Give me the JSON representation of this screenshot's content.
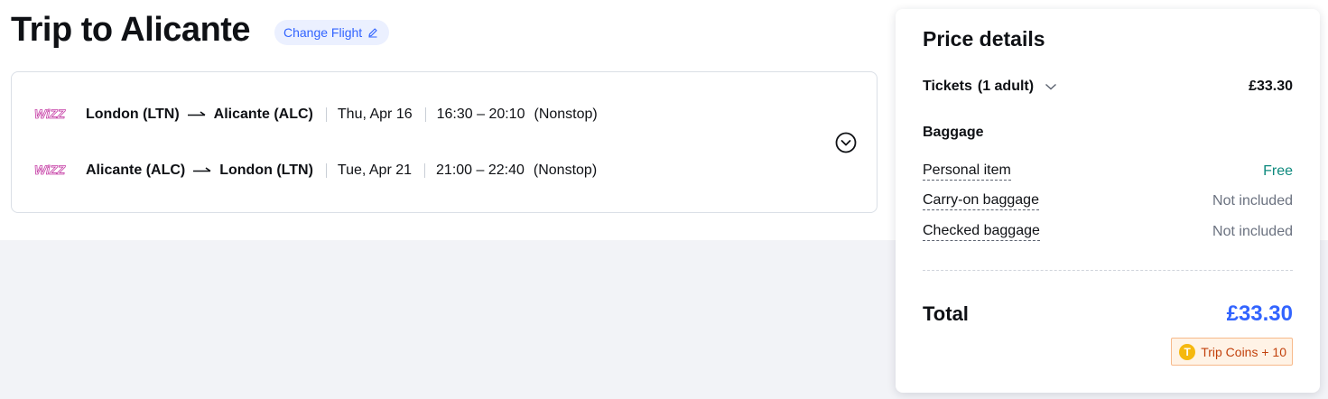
{
  "header": {
    "title": "Trip to Alicante",
    "change_flight_label": "Change Flight"
  },
  "flights": [
    {
      "airline_icon": "wizz-air-logo",
      "from": "London (LTN)",
      "to": "Alicante (ALC)",
      "date": "Thu, Apr 16",
      "times": "16:30 – 20:10",
      "stops": "(Nonstop)"
    },
    {
      "airline_icon": "wizz-air-logo",
      "from": "Alicante (ALC)",
      "to": "London (LTN)",
      "date": "Tue, Apr 21",
      "times": "21:00 – 22:40",
      "stops": "(Nonstop)"
    }
  ],
  "price": {
    "title": "Price details",
    "tickets_label": "Tickets",
    "tickets_count": "(1 adult)",
    "tickets_value": "£33.30",
    "baggage_title": "Baggage",
    "baggage": [
      {
        "label": "Personal item",
        "value": "Free"
      },
      {
        "label": "Carry-on baggage",
        "value": "Not included"
      },
      {
        "label": "Checked baggage",
        "value": "Not included"
      }
    ],
    "total_label": "Total",
    "total_value": "£33.30",
    "coins_icon_letter": "T",
    "coins_label": "Trip Coins + 10"
  },
  "colors": {
    "accent": "#3264ff",
    "free": "#0e8a7e",
    "coins": "#c2410c",
    "wizz": "#c63fa6"
  }
}
